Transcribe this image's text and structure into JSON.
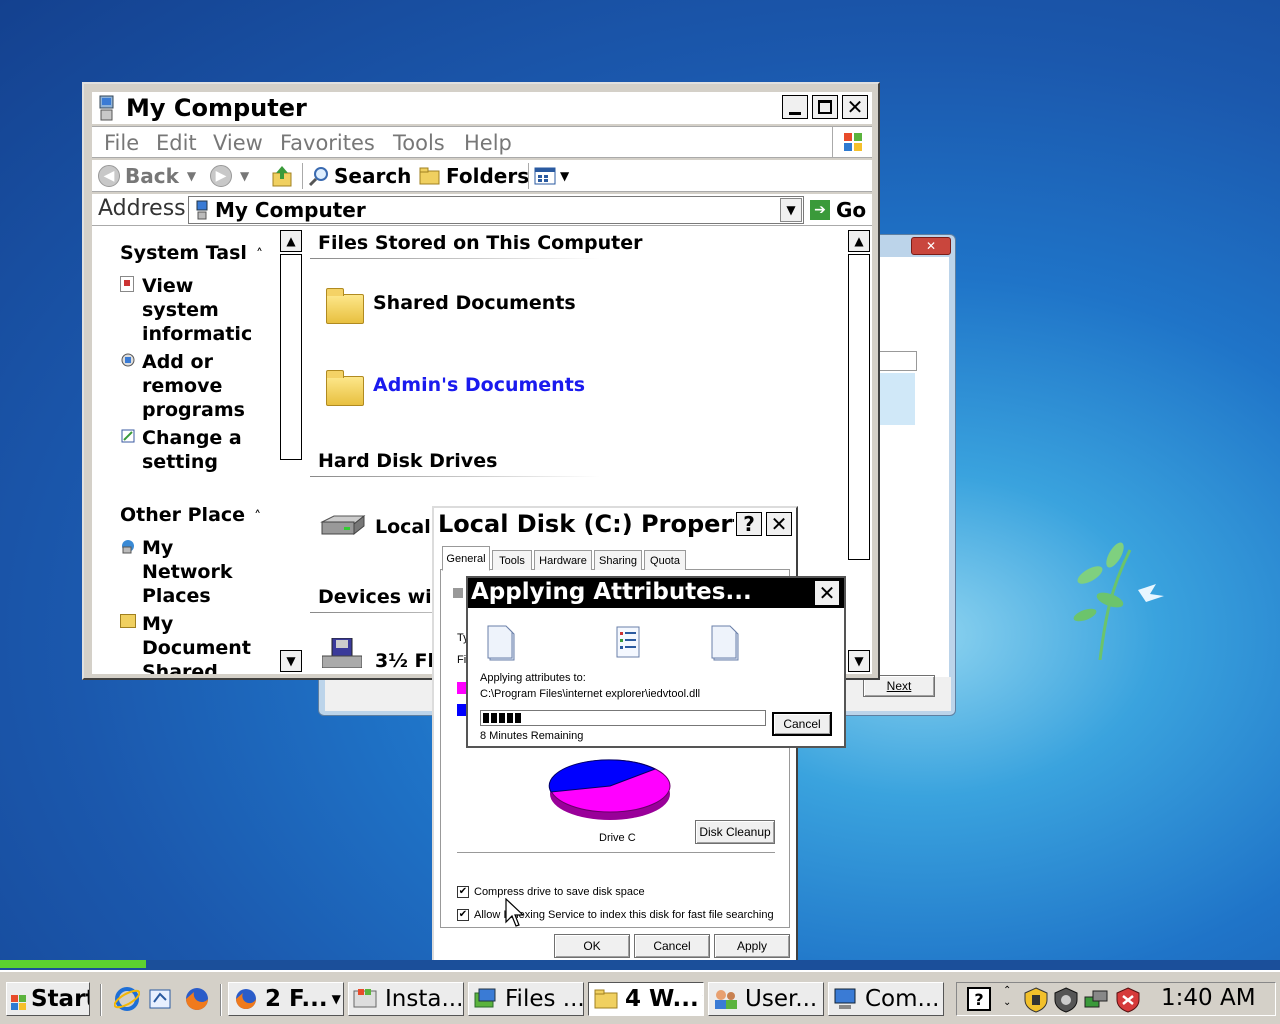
{
  "desktop": {
    "bg_color": "#1b58ad"
  },
  "back_window": {
    "next_label": "Next"
  },
  "my_computer": {
    "title": "My Computer",
    "menu": [
      "File",
      "Edit",
      "View",
      "Favorites",
      "Tools",
      "Help"
    ],
    "toolbar": {
      "back": "Back",
      "search": "Search",
      "folders": "Folders"
    },
    "address": {
      "label": "Address",
      "value": "My Computer",
      "go": "Go"
    },
    "tasks": {
      "system_title": "System Tasl",
      "system_items": [
        [
          "View",
          "system",
          "informatic"
        ],
        [
          "Add or",
          "remove",
          "programs"
        ],
        [
          "Change a",
          "setting"
        ]
      ],
      "other_title": "Other Place",
      "other_items": [
        [
          "My",
          "Network",
          "Places"
        ],
        [
          "My",
          "Document",
          "Shared"
        ]
      ]
    },
    "sections": {
      "files_stored": "Files Stored on This Computer",
      "shared_documents": "Shared Documents",
      "admin_documents": "Admin's Documents",
      "hard_disk_drives": "Hard Disk Drives",
      "local_disk": "Local",
      "devices": "Devices wit",
      "floppy": "3½ Fl"
    }
  },
  "properties": {
    "title": "Local Disk (C:) Propert...",
    "tabs": [
      "General",
      "Tools",
      "Hardware",
      "Sharing",
      "Quota"
    ],
    "type_stub": "Ty",
    "fs_stub": "Fi",
    "drive_label": "Drive C",
    "disk_cleanup": "Disk Cleanup",
    "compress_label": "Compress drive to save disk space",
    "index_label": "Allow Indexing Service to index this disk for fast file searching",
    "compress_checked": true,
    "index_checked": true,
    "ok": "OK",
    "cancel": "Cancel",
    "apply": "Apply",
    "used_color": "#ff00ff",
    "free_color": "#0000ff"
  },
  "applying": {
    "title": "Applying Attributes...",
    "applying_to": "Applying attributes to:",
    "path": "C:\\Program Files\\internet explorer\\iedvtool.dll",
    "progress": 0.14,
    "remaining": "8 Minutes Remaining",
    "cancel": "Cancel"
  },
  "taskbar": {
    "start": "Start",
    "buttons": [
      "2 F...",
      "Insta...",
      "Files ...",
      "4 W...",
      "User...",
      "Com..."
    ],
    "clock": "1:40 AM"
  }
}
